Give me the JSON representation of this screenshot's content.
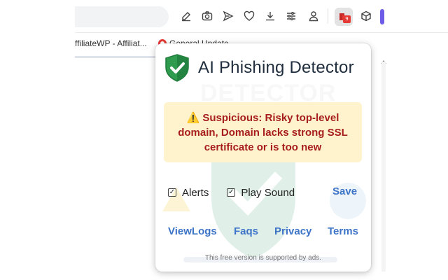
{
  "bookmarks": [
    {
      "label": "ffiliateWP - Affiliat..."
    },
    {
      "label": "General Update"
    }
  ],
  "toolbar_icons": [
    "edit-icon",
    "camera-icon",
    "send-icon",
    "heart-icon",
    "download-icon",
    "sliders-icon",
    "user-icon",
    "extension-active-icon",
    "cube-icon"
  ],
  "extension_badge": "9",
  "popup": {
    "title": "AI Phishing Detector",
    "watermark": "DETECTOR",
    "alert": {
      "icon": "⚠️",
      "text": "Suspicious: Risky top-level domain, Domain lacks strong SSL certificate or is too new",
      "background": "#fff3cd",
      "color": "#a61d1d"
    },
    "options": [
      {
        "label": "Alerts",
        "checked": true
      },
      {
        "label": "Play Sound",
        "checked": true
      }
    ],
    "save_label": "Save",
    "links": [
      "ViewLogs",
      "Faqs",
      "Privacy",
      "Terms"
    ],
    "footer": "This free version is supported by ads.",
    "accent_color": "#3d74c8",
    "shield_color": "#2e9b4e"
  }
}
